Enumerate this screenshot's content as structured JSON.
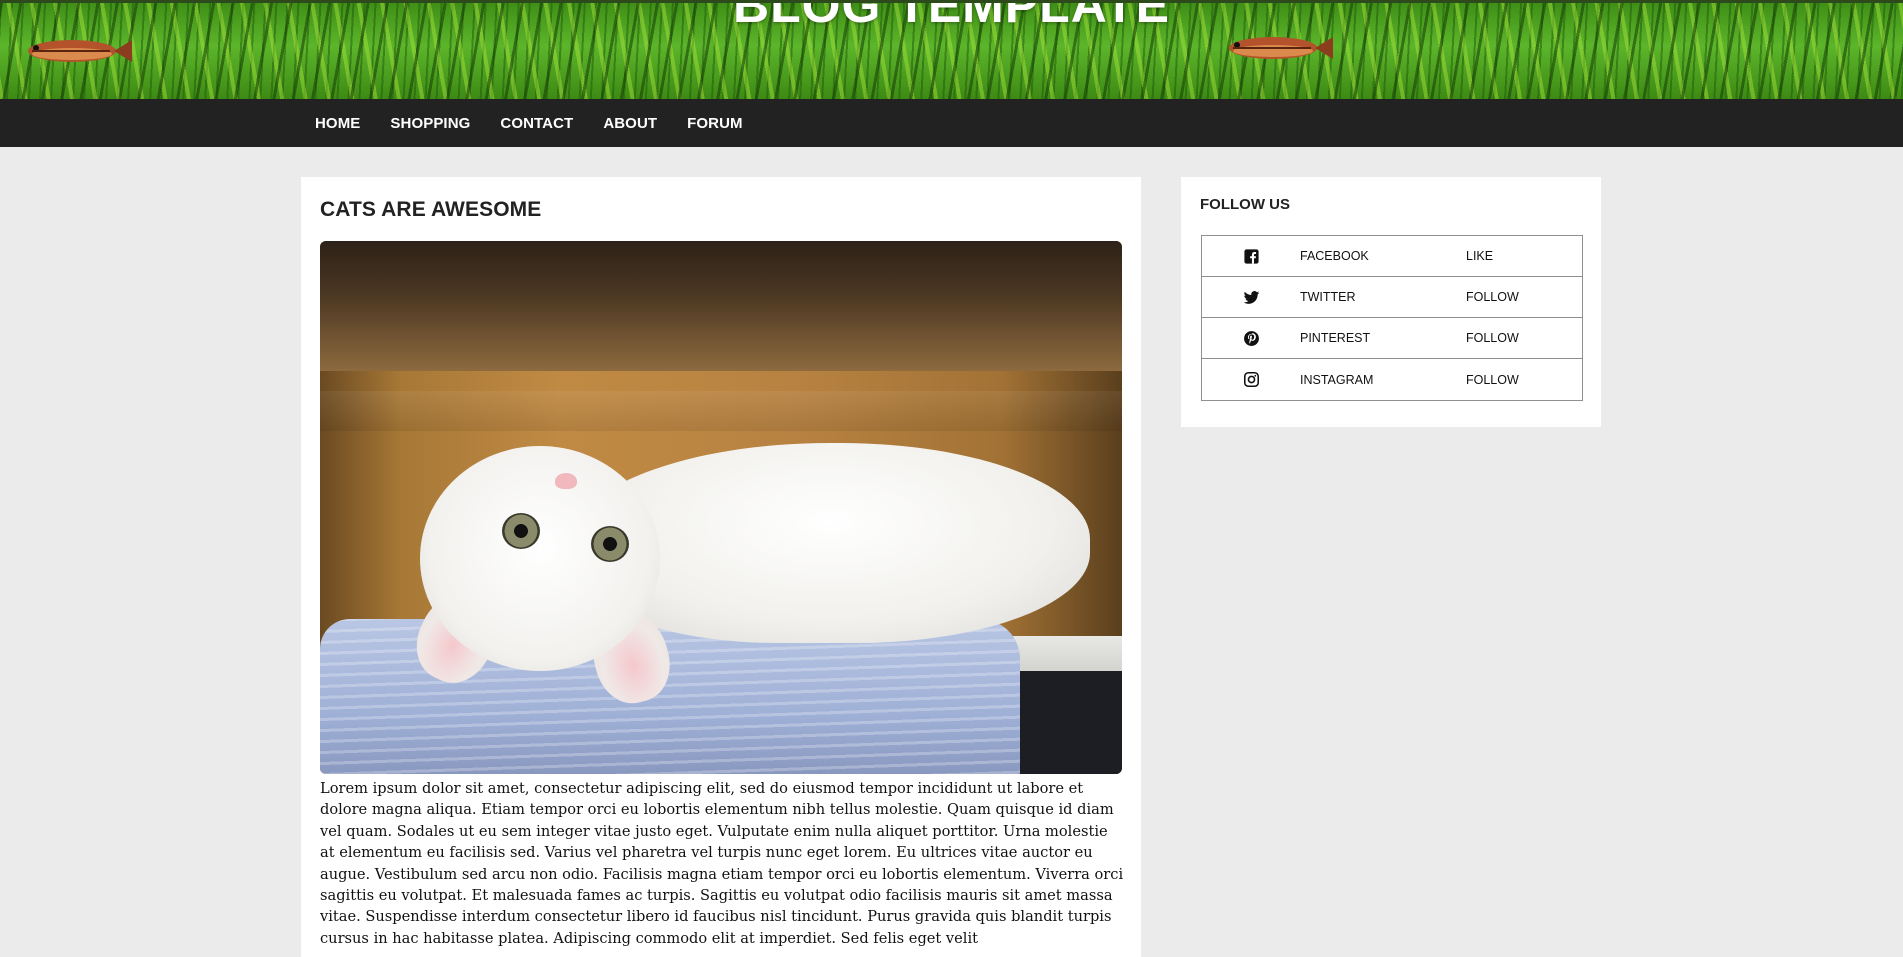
{
  "site": {
    "banner_title": "BLOG TEMPLATE"
  },
  "nav": {
    "items": [
      {
        "label": "HOME"
      },
      {
        "label": "SHOPPING"
      },
      {
        "label": "CONTACT"
      },
      {
        "label": "ABOUT"
      },
      {
        "label": "FORUM"
      }
    ]
  },
  "article": {
    "title": "CATS ARE AWESOME",
    "image_alt": "white kitten lying on a blue towel",
    "body": "Lorem ipsum dolor sit amet, consectetur adipiscing elit, sed do eiusmod tempor incididunt ut labore et dolore magna aliqua. Etiam tempor orci eu lobortis elementum nibh tellus molestie. Quam quisque id diam vel quam. Sodales ut eu sem integer vitae justo eget. Vulputate enim nulla aliquet porttitor. Urna molestie at elementum eu facilisis sed. Varius vel pharetra vel turpis nunc eget lorem. Eu ultrices vitae auctor eu augue. Vestibulum sed arcu non odio. Facilisis magna etiam tempor orci eu lobortis elementum. Viverra orci sagittis eu volutpat. Et malesuada fames ac turpis. Sagittis eu volutpat odio facilisis mauris sit amet massa vitae. Suspendisse interdum consectetur libero id faucibus nisl tincidunt. Purus gravida quis blandit turpis cursus in hac habitasse platea. Adipiscing commodo elit at imperdiet. Sed felis eget velit"
  },
  "sidebar": {
    "title": "FOLLOW US",
    "social": [
      {
        "icon": "facebook-icon",
        "name": "FACEBOOK",
        "action": "LIKE"
      },
      {
        "icon": "twitter-icon",
        "name": "TWITTER",
        "action": "FOLLOW"
      },
      {
        "icon": "pinterest-icon",
        "name": "PINTEREST",
        "action": "FOLLOW"
      },
      {
        "icon": "instagram-icon",
        "name": "INSTAGRAM",
        "action": "FOLLOW"
      }
    ]
  },
  "colors": {
    "page_background": "#ebebeb",
    "nav_background": "#222222",
    "card_background": "#ffffff",
    "banner_green": "#4fa622"
  }
}
